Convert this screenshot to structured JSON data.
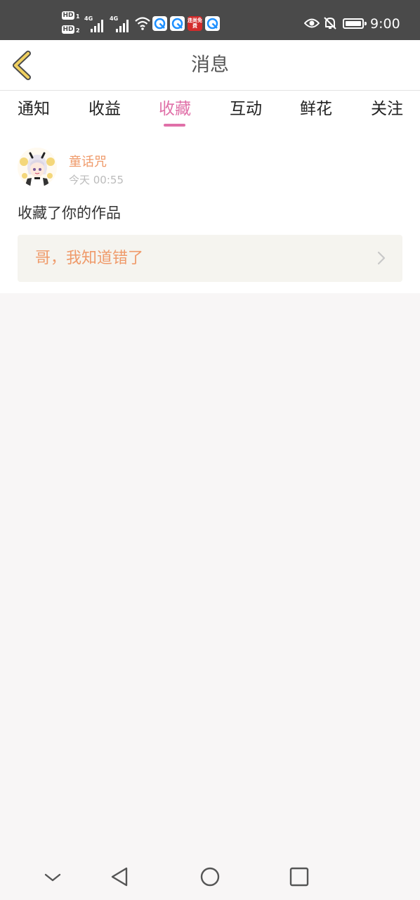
{
  "status_bar": {
    "sim1_label": "HD",
    "sim1_index": "1",
    "sim2_label": "HD",
    "sim2_index": "2",
    "network1": "4G",
    "network2": "4G",
    "app_icon_text": "连尚免费",
    "time": "9:00",
    "icons": [
      "wifi-icon",
      "browser-icon",
      "eye-icon",
      "bell-off-icon",
      "battery-icon"
    ]
  },
  "header": {
    "title": "消息",
    "back_icon": "chevron-left-icon",
    "accent_color": "#f0d060"
  },
  "tabs": [
    {
      "label": "通知",
      "active": false
    },
    {
      "label": "收益",
      "active": false
    },
    {
      "label": "收藏",
      "active": true
    },
    {
      "label": "互动",
      "active": false
    },
    {
      "label": "鲜花",
      "active": false
    },
    {
      "label": "关注",
      "active": false
    }
  ],
  "message": {
    "username": "童话咒",
    "timestamp": "今天 00:55",
    "action": "收藏了你的作品",
    "work_title": "哥，我知道错了"
  },
  "colors": {
    "accent_pink": "#e070a8",
    "accent_orange": "#ef9a6a"
  },
  "nav_bar": {
    "icons": [
      "chevron-down-icon",
      "back-triangle-icon",
      "home-circle-icon",
      "recents-square-icon"
    ]
  }
}
